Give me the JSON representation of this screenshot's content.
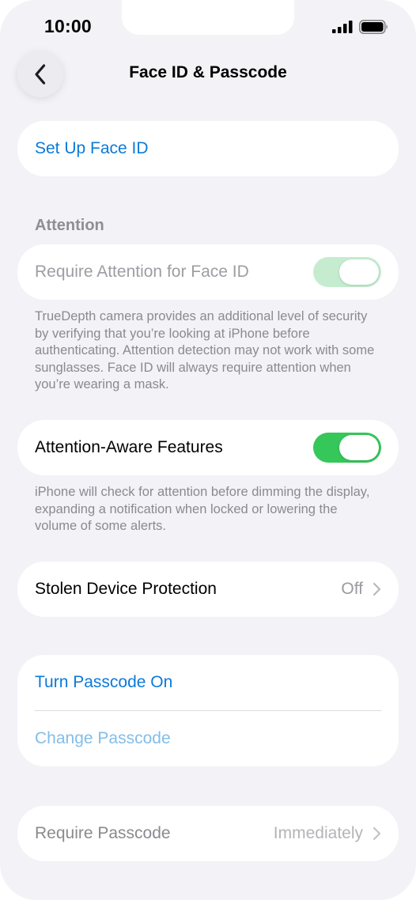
{
  "status_bar": {
    "time": "10:00"
  },
  "nav": {
    "title": "Face ID & Passcode"
  },
  "face_id": {
    "setup_label": "Set Up Face ID"
  },
  "attention": {
    "header": "Attention",
    "require_label": "Require Attention for Face ID",
    "require_enabled": true,
    "require_disabled": true,
    "footer": "TrueDepth camera provides an additional level of security by verifying that you’re looking at iPhone before authenticating. Attention detection may not work with some sunglasses. Face ID will always require attention when you’re wearing a mask.",
    "aware_label": "Attention-Aware Features",
    "aware_enabled": true,
    "aware_footer": "iPhone will check for attention before dimming the display, expanding a notification when locked or lowering the volume of some alerts."
  },
  "stolen_device": {
    "label": "Stolen Device Protection",
    "value": "Off"
  },
  "passcode": {
    "turn_on_label": "Turn Passcode On",
    "change_label": "Change Passcode",
    "require_label": "Require Passcode",
    "require_value": "Immediately"
  },
  "colors": {
    "accent_blue": "#0a7ad9",
    "toggle_green": "#35c759",
    "background": "#f2f2f7"
  },
  "icons": {
    "back": "chevron-left-icon",
    "row_chevron": "chevron-right-icon",
    "signal": "cellular-signal-icon",
    "battery": "battery-icon"
  }
}
